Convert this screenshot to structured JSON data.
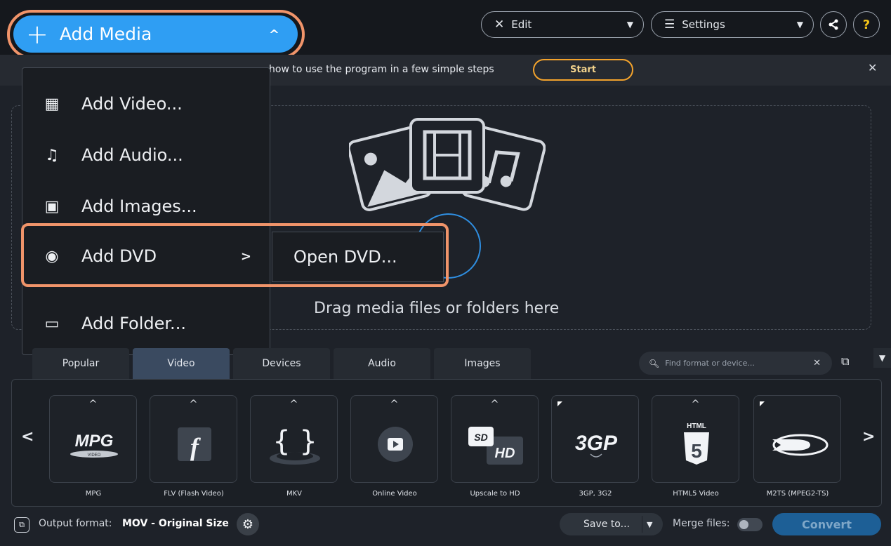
{
  "header": {
    "add_media_label": "Add Media",
    "edit_label": "Edit",
    "settings_label": "Settings",
    "help_label": "?"
  },
  "hint": {
    "text": "how to use the program in a few simple steps",
    "start_label": "Start"
  },
  "add_media_menu": {
    "items": [
      {
        "label": "Add Video...",
        "icon": "film-strip-icon"
      },
      {
        "label": "Add Audio...",
        "icon": "music-note-icon"
      },
      {
        "label": "Add Images...",
        "icon": "image-icon"
      },
      {
        "label": "Add DVD",
        "icon": "disc-icon"
      },
      {
        "label": "Add Folder...",
        "icon": "folder-icon"
      }
    ],
    "submenu_item": "Open DVD..."
  },
  "dropzone": {
    "text": "Drag media files or folders here"
  },
  "format_panel": {
    "tabs": [
      "Popular",
      "Video",
      "Devices",
      "Audio",
      "Images"
    ],
    "active_tab": "Video",
    "search_placeholder": "Find format or device...",
    "tiles": [
      {
        "label": "MPG",
        "icon": "mpg-logo-icon"
      },
      {
        "label": "FLV (Flash Video)",
        "icon": "flash-logo-icon"
      },
      {
        "label": "MKV",
        "icon": "mkv-logo-icon"
      },
      {
        "label": "Online Video",
        "icon": "play-button-icon"
      },
      {
        "label": "Upscale to HD",
        "icon": "sd-hd-icon"
      },
      {
        "label": "3GP, 3G2",
        "icon": "3gp-logo-icon"
      },
      {
        "label": "HTML5 Video",
        "icon": "html5-logo-icon"
      },
      {
        "label": "M2TS (MPEG2-TS)",
        "icon": "bluray-logo-icon"
      }
    ]
  },
  "bottom": {
    "output_label": "Output format:",
    "output_value": "MOV - Original Size",
    "save_to_label": "Save to...",
    "merge_label": "Merge files:",
    "convert_label": "Convert"
  },
  "colors": {
    "accent_blue": "#2f9ef3",
    "highlight": "#f0946a",
    "start_border": "#f3a32c",
    "background": "#1e2229"
  }
}
